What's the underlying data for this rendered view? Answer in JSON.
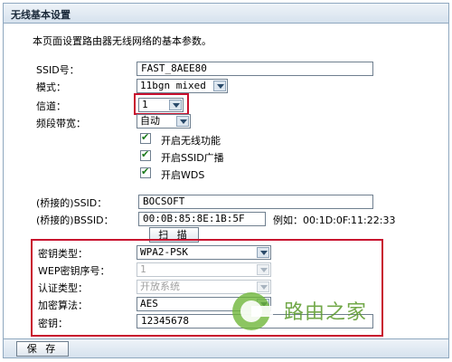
{
  "panel": {
    "title": "无线基本设置",
    "description": "本页面设置路由器无线网络的基本参数。"
  },
  "form": {
    "ssid": {
      "label": "SSID号：",
      "value": "FAST_8AEE80"
    },
    "mode": {
      "label": "模式：",
      "value": "11bgn mixed"
    },
    "channel": {
      "label": "信道：",
      "value": "1"
    },
    "bandwidth": {
      "label": "频段带宽：",
      "value": "自动"
    },
    "checkboxes": [
      {
        "label": "开启无线功能",
        "checked": true
      },
      {
        "label": "开启SSID广播",
        "checked": true
      },
      {
        "label": "开启WDS",
        "checked": true
      }
    ],
    "bridged_ssid": {
      "label": "(桥接的)SSID：",
      "value": "BOCSOFT"
    },
    "bridged_bssid": {
      "label": "(桥接的)BSSID：",
      "value": "00:0B:85:8E:1B:5F",
      "example": "例如：00:1D:0F:11:22:33"
    },
    "scan_button": "扫 描",
    "key_type": {
      "label": "密钥类型：",
      "value": "WPA2-PSK"
    },
    "wep_index": {
      "label": "WEP密钥序号：",
      "value": "1"
    },
    "auth_type": {
      "label": "认证类型：",
      "value": "开放系统"
    },
    "encryption": {
      "label": "加密算法：",
      "value": "AES"
    },
    "key": {
      "label": "密钥：",
      "value": "12345678"
    }
  },
  "footer": {
    "save_button": "保 存"
  },
  "watermark": {
    "text": "路由之家",
    "logo_icon": "router-home-logo"
  },
  "colors": {
    "highlight": "#c8102e",
    "panel_border": "#8fa8bf",
    "check": "#1a7a1a"
  }
}
